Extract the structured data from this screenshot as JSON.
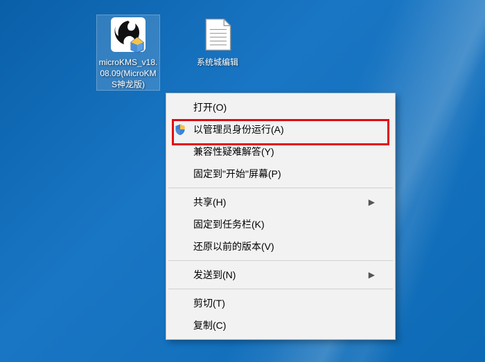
{
  "desktop": {
    "icons": [
      {
        "label": "microKMS_v18.08.09(MicroKMS神龙版)"
      },
      {
        "label": "系统城编辑"
      }
    ]
  },
  "context_menu": {
    "groups": [
      [
        {
          "label": "打开(O)",
          "icon": null,
          "submenu": false
        },
        {
          "label": "以管理员身份运行(A)",
          "icon": "shield-icon",
          "submenu": false
        },
        {
          "label": "兼容性疑难解答(Y)",
          "icon": null,
          "submenu": false
        },
        {
          "label": "固定到\"开始\"屏幕(P)",
          "icon": null,
          "submenu": false
        }
      ],
      [
        {
          "label": "共享(H)",
          "icon": null,
          "submenu": true
        },
        {
          "label": "固定到任务栏(K)",
          "icon": null,
          "submenu": false
        },
        {
          "label": "还原以前的版本(V)",
          "icon": null,
          "submenu": false
        }
      ],
      [
        {
          "label": "发送到(N)",
          "icon": null,
          "submenu": true
        }
      ],
      [
        {
          "label": "剪切(T)",
          "icon": null,
          "submenu": false
        },
        {
          "label": "复制(C)",
          "icon": null,
          "submenu": false
        }
      ]
    ]
  }
}
